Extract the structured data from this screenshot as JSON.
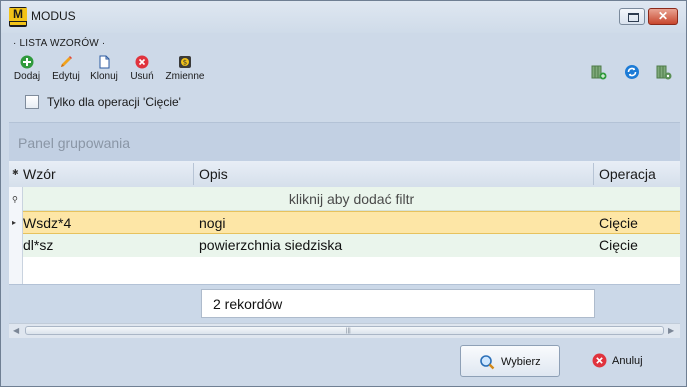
{
  "window": {
    "title": "MODUS",
    "logo_text": "M"
  },
  "toolbar": {
    "group_label": "· LISTA WZORÓW ·",
    "buttons": [
      {
        "id": "dodaj",
        "label": "Dodaj",
        "icon": "add-icon"
      },
      {
        "id": "edytuj",
        "label": "Edytuj",
        "icon": "pencil-icon"
      },
      {
        "id": "klonuj",
        "label": "Klonuj",
        "icon": "document-icon"
      },
      {
        "id": "usun",
        "label": "Usuń",
        "icon": "delete-icon"
      },
      {
        "id": "zmienne",
        "label": "Zmienne",
        "icon": "variables-icon"
      }
    ],
    "right_icons": [
      "grid-add-icon",
      "refresh-icon",
      "grid-settings-icon"
    ],
    "checkbox": {
      "label": "Tylko dla operacji 'Cięcie'",
      "checked": false
    }
  },
  "grouping_panel": {
    "placeholder": "Panel grupowania"
  },
  "table": {
    "columns": [
      "Wzór",
      "Opis",
      "Operacja"
    ],
    "filter_placeholder": "kliknij aby dodać filtr",
    "rows": [
      {
        "wzor": "Wsdz*4",
        "opis": "nogi",
        "operacja": "Cięcie"
      },
      {
        "wzor": "dl*sz",
        "opis": "powierzchnia siedziska",
        "operacja": "Cięcie"
      }
    ],
    "record_count": "2 rekordów"
  },
  "footer": {
    "select_label": "Wybierz",
    "cancel_label": "Anuluj"
  },
  "colors": {
    "selected_row": "#fde6a6",
    "alt_row": "#eaf5ec",
    "window_bg": "#cdd9e8"
  }
}
